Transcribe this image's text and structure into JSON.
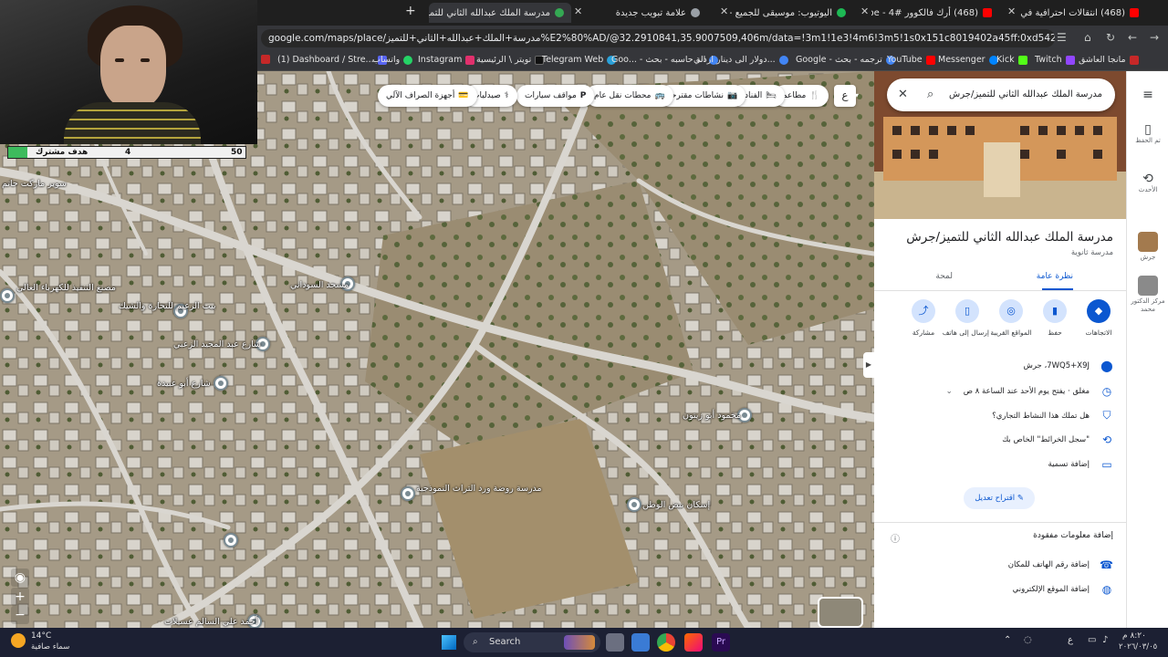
{
  "browser": {
    "tabs": [
      {
        "label": "مدرسة الملك عبدالله الثاني للتميز",
        "active": true,
        "color": "#34a853"
      },
      {
        "label": "علامة تبويب جديدة",
        "active": false,
        "color": "#9aa0a6"
      },
      {
        "label": "اليوتيوب: موسيقى للجميع - Spotify",
        "active": false,
        "color": "#1db954"
      },
      {
        "label": "(468) أرك فالكوور #4 - YouTube",
        "active": false,
        "color": "#ff0000"
      },
      {
        "label": "(468) انتقالات احترافية في المونتاج",
        "active": false,
        "color": "#ff0000"
      }
    ],
    "url": "google.com/maps/place/مدرسة+الملك+عبدالله+الثاني+للتميز%E2%80%AD/@32.2910841,35.9007509,406m/data=!3m1!1e3!4m6!3m5!1s0x151c8019402a45ff:0xd5426815c6b95d5e!8m2!3d32.2899514d35.9084054!16s%2Fg%2F11fx",
    "bookmarks": [
      {
        "label": "(1) Dashboard / Stre...",
        "color": "#5865f2"
      },
      {
        "label": "واتساب",
        "color": "#25d366"
      },
      {
        "label": "Instagram",
        "color": "#e1306c"
      },
      {
        "label": "تويتر \\ الرئيسية",
        "color": "#111111"
      },
      {
        "label": "Telegram Web",
        "color": "#2aa1da"
      },
      {
        "label": "Goo... - الة حاسبه - بحث",
        "color": "#4285f4"
      },
      {
        "label": "دولار الى دينار اردني...",
        "color": "#4285f4"
      },
      {
        "label": "Google - ترجمه - بحث",
        "color": "#4285f4"
      },
      {
        "label": "YouTube",
        "color": "#ff0000"
      },
      {
        "label": "Messenger",
        "color": "#0084ff"
      },
      {
        "label": "Kick",
        "color": "#53fc18"
      },
      {
        "label": "Twitch",
        "color": "#9146ff"
      },
      {
        "label": "مانجا العاشق",
        "color": "#c62828"
      }
    ]
  },
  "stream_goal": {
    "label": "هدف مشترك",
    "current": "4",
    "target": "50",
    "progress": 0.08
  },
  "map": {
    "filter_chips": [
      {
        "label": "مطاعم",
        "icon": "fork-knife-icon"
      },
      {
        "label": "الفنادق",
        "icon": "bed-icon"
      },
      {
        "label": "نشاطات مقترحة",
        "icon": "camera-icon"
      },
      {
        "label": "محطات نقل عام",
        "icon": "bus-icon"
      },
      {
        "label": "مواقف سيارات",
        "icon": "parking-icon"
      },
      {
        "label": "صيدليات",
        "icon": "pharmacy-icon"
      },
      {
        "label": "أجهزة الصراف الآلي",
        "icon": "atm-icon"
      }
    ],
    "language_button": "ع",
    "places": [
      {
        "label": "مسجد السوداني"
      },
      {
        "label": "سوبر ماركت حاتم"
      },
      {
        "label": "بيت الزعيم للتجارة والشيك"
      },
      {
        "label": "مصنع التنفيذ للكهرباء العالي"
      },
      {
        "label": "شارع عبد المجيد الزعبي"
      },
      {
        "label": "شارع أبو عبيدة"
      },
      {
        "label": "محمود أبو زيتون"
      },
      {
        "label": "مدرسة روضة ورد التراث النموذجية"
      },
      {
        "label": "إسكان نبض الوطن"
      },
      {
        "label": "أحمد علي السالم عسيلات"
      }
    ],
    "controls": {
      "locate": "◉",
      "zoom_in": "+",
      "zoom_out": "−"
    }
  },
  "panel": {
    "search_value": "مدرسة الملك عبدالله الثاني للتميز/جرش",
    "title": "مدرسة الملك عبدالله الثاني للتميز/جرش",
    "subtitle": "مدرسة ثانوية",
    "tabs": [
      {
        "label": "نظرة عامة",
        "active": true
      },
      {
        "label": "لمحة",
        "active": false
      }
    ],
    "actions": [
      {
        "label": "الاتجاهات",
        "icon": "directions-icon"
      },
      {
        "label": "حفظ",
        "icon": "bookmark-icon"
      },
      {
        "label": "المواقع القريبة",
        "icon": "nearby-icon"
      },
      {
        "label": "إرسال إلى هاتف",
        "icon": "phone-send-icon"
      },
      {
        "label": "مشاركة",
        "icon": "share-icon"
      }
    ],
    "info_rows": [
      {
        "text": "7WQ5+X9J، جرش",
        "icon": "pin-icon"
      },
      {
        "text": "مغلق · يفتح يوم الأحد عند الساعة ٨ ص",
        "icon": "clock-icon"
      },
      {
        "text": "هل تملك هذا النشاط التجاري؟",
        "icon": "shield-icon"
      },
      {
        "text": "\"سجل الخرائط\" الخاص بك",
        "icon": "history-icon"
      },
      {
        "text": "إضافة تسمية",
        "icon": "label-icon"
      }
    ],
    "suggest_edit": "اقتراح تعديل",
    "missing_info_title": "إضافة معلومات مفقودة",
    "missing_rows": [
      {
        "text": "إضافة رقم الهاتف للمكان",
        "icon": "phone-icon"
      },
      {
        "text": "إضافة الموقع الإلكتروني",
        "icon": "globe-icon"
      }
    ]
  },
  "rail": {
    "items": [
      {
        "label": "تم الحفظ",
        "icon": "bookmark-icon"
      },
      {
        "label": "الأحدث",
        "icon": "history-icon"
      },
      {
        "label": "جرش",
        "icon": "place-thumb-icon"
      },
      {
        "label": "مركز الدكتور محمد",
        "icon": "place-thumb-icon"
      }
    ]
  },
  "taskbar": {
    "weather_temp": "14°C",
    "weather_desc": "سماء صافية",
    "search_label": "Search",
    "clock_time": "٨:٢٠ م",
    "clock_date": "٢٠٢٦/٠٣/٠٥",
    "lang": "ع"
  }
}
